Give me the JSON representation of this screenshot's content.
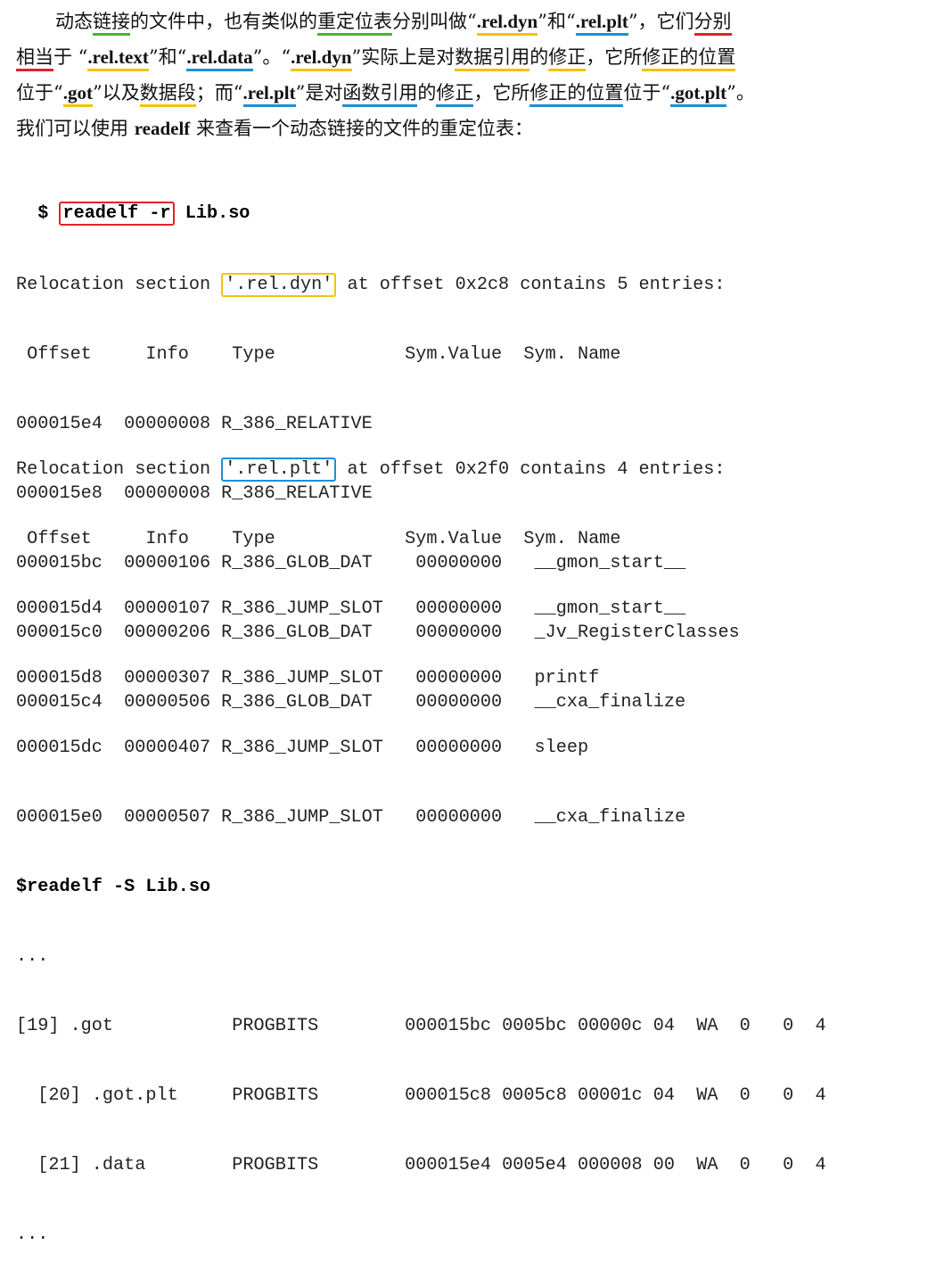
{
  "paragraph": {
    "l1": [
      {
        "t": "动态"
      },
      {
        "t": "链接",
        "u": "g"
      },
      {
        "t": "的文件中，也有类似的"
      },
      {
        "t": "重定位表",
        "u": "g"
      },
      {
        "t": "分别叫做“"
      },
      {
        "t": ".rel.dyn",
        "u": "y",
        "b": true
      },
      {
        "t": "”和“"
      },
      {
        "t": ".rel.plt",
        "u": "bl",
        "b": true
      },
      {
        "t": "”，它们"
      },
      {
        "t": "分别",
        "u": "r"
      }
    ],
    "l2": [
      {
        "t": "相当",
        "u": "r"
      },
      {
        "t": "于  “"
      },
      {
        "t": ".rel.text",
        "u": "y",
        "b": true
      },
      {
        "t": "”和“"
      },
      {
        "t": ".rel.data",
        "u": "bl",
        "b": true
      },
      {
        "t": "”。“"
      },
      {
        "t": ".rel.dyn",
        "u": "y",
        "b": true
      },
      {
        "t": "”实际上是对"
      },
      {
        "t": "数据引用",
        "u": "y"
      },
      {
        "t": "的"
      },
      {
        "t": "修正",
        "u": "y"
      },
      {
        "t": "，它所"
      },
      {
        "t": "修正的位置",
        "u": "y"
      }
    ],
    "l3": [
      {
        "t": "位于“"
      },
      {
        "t": ".got",
        "u": "y",
        "b": true
      },
      {
        "t": "”以及"
      },
      {
        "t": "数据段",
        "u": "y"
      },
      {
        "t": "；而“"
      },
      {
        "t": ".rel.plt",
        "u": "bl",
        "b": true
      },
      {
        "t": "”是对"
      },
      {
        "t": "函数引用",
        "u": "bl"
      },
      {
        "t": "的"
      },
      {
        "t": "修正",
        "u": "bl"
      },
      {
        "t": "，它所"
      },
      {
        "t": "修正的位置",
        "u": "bl"
      },
      {
        "t": "位于“"
      },
      {
        "t": ".got.plt",
        "u": "bl",
        "b": true
      },
      {
        "t": "”。"
      }
    ],
    "l4": [
      {
        "t": "我们可以使用 "
      },
      {
        "t": "readelf",
        "b": true
      },
      {
        "t": " 来查看一个动态链接的文件的重定位表："
      }
    ]
  },
  "command1": {
    "prompt": "$ ",
    "cmd": "readelf -r",
    "arg": " Lib.so"
  },
  "rel_dyn": {
    "pre": "Relocation section ",
    "name": "'.rel.dyn'",
    "post": " at offset 0x2c8 contains 5 entries:",
    "header": " Offset     Info    Type            Sym.Value  Sym. Name",
    "rows": [
      "000015e4  00000008 R_386_RELATIVE",
      "000015e8  00000008 R_386_RELATIVE",
      "000015bc  00000106 R_386_GLOB_DAT    00000000   __gmon_start__",
      "000015c0  00000206 R_386_GLOB_DAT    00000000   _Jv_RegisterClasses",
      "000015c4  00000506 R_386_GLOB_DAT    00000000   __cxa_finalize"
    ]
  },
  "rel_plt": {
    "pre": "Relocation section ",
    "name": "'.rel.plt'",
    "post": " at offset 0x2f0 contains 4 entries:",
    "header": " Offset     Info    Type            Sym.Value  Sym. Name",
    "rows": [
      "000015d4  00000107 R_386_JUMP_SLOT   00000000   __gmon_start__",
      "000015d8  00000307 R_386_JUMP_SLOT   00000000   printf",
      "000015dc  00000407 R_386_JUMP_SLOT   00000000   sleep",
      "000015e0  00000507 R_386_JUMP_SLOT   00000000   __cxa_finalize"
    ]
  },
  "command2": "$readelf -S Lib.so",
  "sections": {
    "ellipsis_top": "...",
    "rows": [
      "[19] .got           PROGBITS        000015bc 0005bc 00000c 04  WA  0   0  4",
      "  [20] .got.plt     PROGBITS        000015c8 0005c8 00001c 04  WA  0   0  4",
      "  [21] .data        PROGBITS        000015e4 0005e4 000008 00  WA  0   0  4"
    ],
    "ellipsis_bottom": "..."
  },
  "colors": {
    "yellow": "#f4c20d",
    "blue": "#1e8fd6",
    "green": "#4caf3a",
    "red": "#e0212b"
  }
}
